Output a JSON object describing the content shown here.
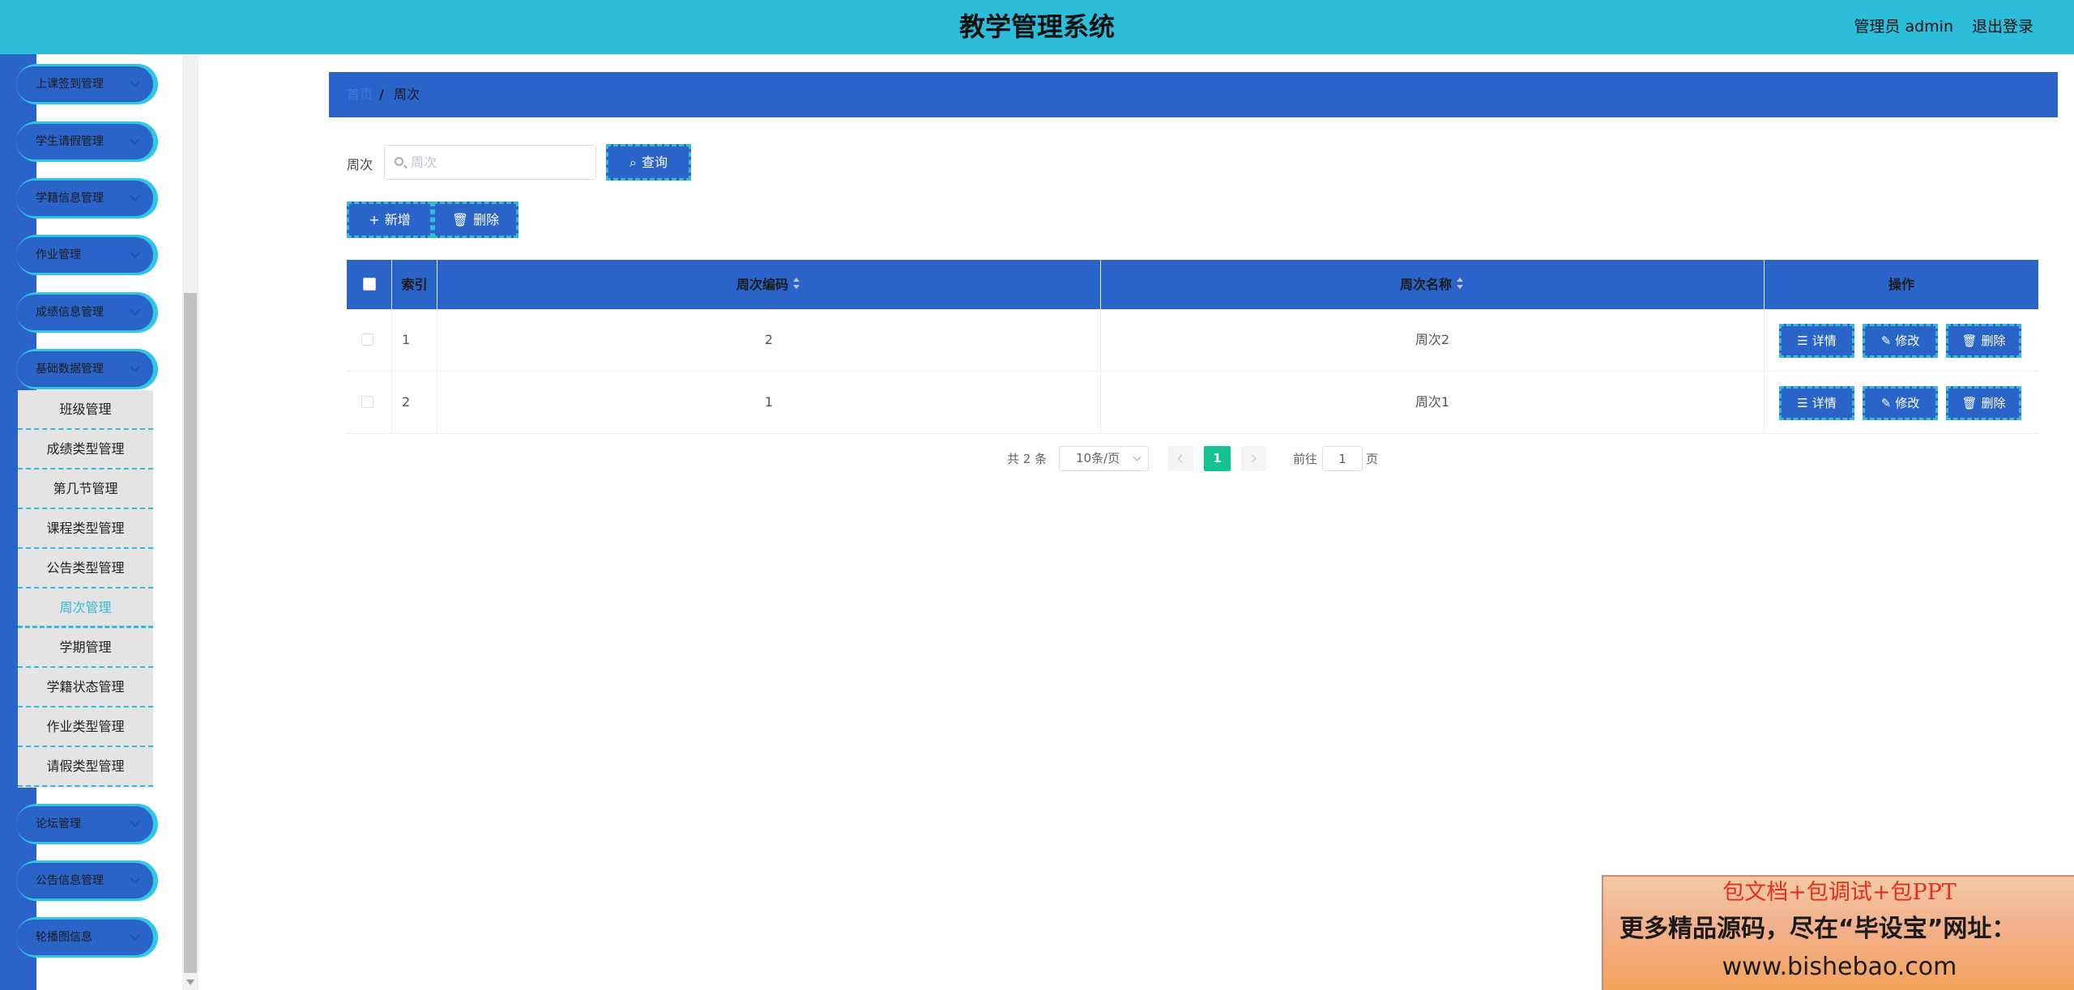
{
  "header": {
    "title": "教学管理系统",
    "user": "管理员 admin",
    "logout": "退出登录"
  },
  "sidebar": {
    "menus_top": [
      "上课签到管理",
      "学生请假管理",
      "学籍信息管理",
      "作业管理",
      "成绩信息管理",
      "基础数据管理"
    ],
    "submenu": [
      "班级管理",
      "成绩类型管理",
      "第几节管理",
      "课程类型管理",
      "公告类型管理",
      "周次管理",
      "学期管理",
      "学籍状态管理",
      "作业类型管理",
      "请假类型管理"
    ],
    "submenu_active": "周次管理",
    "menus_bottom": [
      "论坛管理",
      "公告信息管理",
      "轮播图信息"
    ]
  },
  "breadcrumb": {
    "home": "首页",
    "separator": "/",
    "current": "周次"
  },
  "search": {
    "label": "周次",
    "placeholder": "周次",
    "value": "",
    "button": "查询"
  },
  "actions": {
    "add": "新增",
    "delete": "删除"
  },
  "table": {
    "columns": [
      "索引",
      "周次编码",
      "周次名称",
      "操作"
    ],
    "rows": [
      {
        "index": "1",
        "code": "2",
        "name": "周次2"
      },
      {
        "index": "2",
        "code": "1",
        "name": "周次1"
      }
    ],
    "row_buttons": {
      "detail": "详情",
      "edit": "修改",
      "delete": "删除"
    }
  },
  "pagination": {
    "total": "共 2 条",
    "page_size": "10条/页",
    "current_page": "1",
    "goto_label": "前往",
    "goto_value": "1",
    "goto_unit": "页"
  },
  "ad": {
    "line1": "包文档+包调试+包PPT",
    "line2": "更多精品源码，尽在“毕设宝”网址：",
    "line3": "www.bishebao.com"
  },
  "colors": {
    "header": "#2bbdd9",
    "primary": "#2a64c8",
    "accent": "#35b9d8",
    "page_active": "#13c28f"
  }
}
